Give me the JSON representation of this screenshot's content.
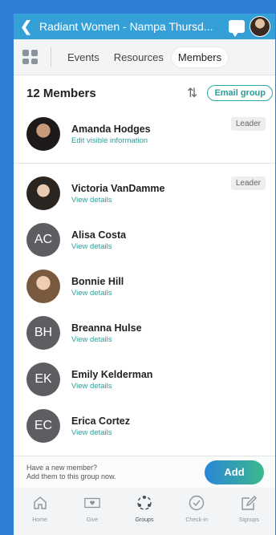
{
  "header": {
    "title": "Radiant Women - Nampa Thursd..."
  },
  "tabs": [
    {
      "label": "Events"
    },
    {
      "label": "Resources"
    },
    {
      "label": "Members"
    }
  ],
  "members_header": {
    "count_label": "12 Members",
    "email_button": "Email group"
  },
  "self_member": {
    "name": "Amanda Hodges",
    "link": "Edit visible information",
    "badge": "Leader"
  },
  "members": [
    {
      "name": "Victoria VanDamme",
      "link": "View details",
      "badge": "Leader",
      "initials": ""
    },
    {
      "name": "Alisa Costa",
      "link": "View details",
      "initials": "AC"
    },
    {
      "name": "Bonnie Hill",
      "link": "View details",
      "initials": ""
    },
    {
      "name": "Breanna Hulse",
      "link": "View details",
      "initials": "BH"
    },
    {
      "name": "Emily Kelderman",
      "link": "View details",
      "initials": "EK"
    },
    {
      "name": "Erica Cortez",
      "link": "View details",
      "initials": "EC"
    }
  ],
  "footer": {
    "line1": "Have a new member?",
    "line2": "Add them to this group now.",
    "add_button": "Add"
  },
  "bottom_nav": [
    {
      "label": "Home",
      "icon": "home-icon"
    },
    {
      "label": "Give",
      "icon": "give-icon"
    },
    {
      "label": "Groups",
      "icon": "groups-icon"
    },
    {
      "label": "Check-in",
      "icon": "check-in-icon"
    },
    {
      "label": "Signups",
      "icon": "signups-icon"
    }
  ],
  "colors": {
    "header": "#35a0d8",
    "accent": "#2a9f9a",
    "background": "#2f7fd6"
  }
}
